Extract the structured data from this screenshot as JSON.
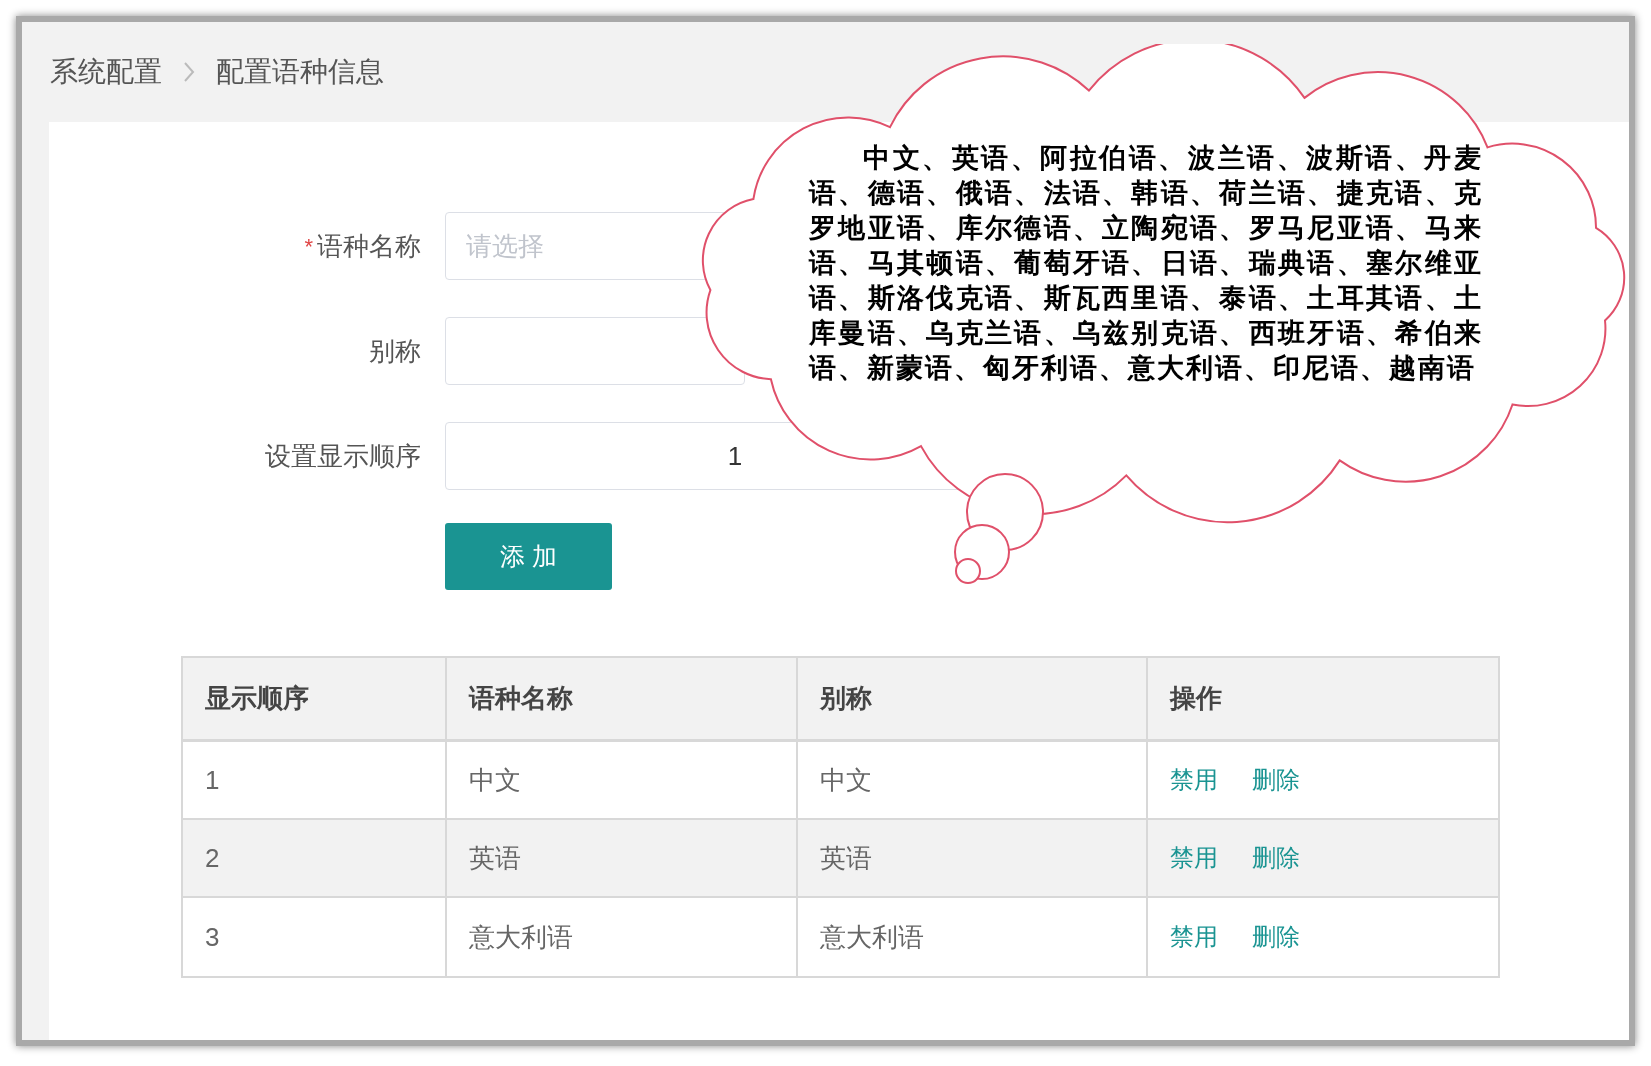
{
  "breadcrumb": [
    {
      "label": "系统配置"
    },
    {
      "label": "配置语种信息"
    }
  ],
  "form": {
    "fields": [
      {
        "label": "语种名称",
        "required_mark": "*",
        "kind": "select",
        "placeholder": "请选择"
      },
      {
        "label": "别称",
        "kind": "text"
      },
      {
        "label": "设置显示顺序",
        "kind": "number",
        "value": "1"
      }
    ],
    "submit": "添 加"
  },
  "table": {
    "columns": [
      "显示顺序",
      "语种名称",
      "别称",
      "操作"
    ],
    "rows": [
      {
        "order": "1",
        "name": "中文",
        "alias": "中文",
        "actions": [
          "禁用",
          "删除"
        ]
      },
      {
        "order": "2",
        "name": "英语",
        "alias": "英语",
        "actions": [
          "禁用",
          "删除"
        ]
      },
      {
        "order": "3",
        "name": "意大利语",
        "alias": "意大利语",
        "actions": [
          "禁用",
          "删除"
        ]
      }
    ]
  },
  "callout": {
    "text": "中文、英语、阿拉伯语、波兰语、波斯语、丹麦语、德语、俄语、法语、韩语、荷兰语、捷克语、克罗地亚语、库尔德语、立陶宛语、罗马尼亚语、马来语、马其顿语、葡萄牙语、日语、瑞典语、塞尔维亚语、斯洛伐克语、斯瓦西里语、泰语、土耳其语、土库曼语、乌克兰语、乌兹别克语、西班牙语、希伯来语、新蒙语、匈牙利语、意大利语、印尼语、越南语"
  }
}
